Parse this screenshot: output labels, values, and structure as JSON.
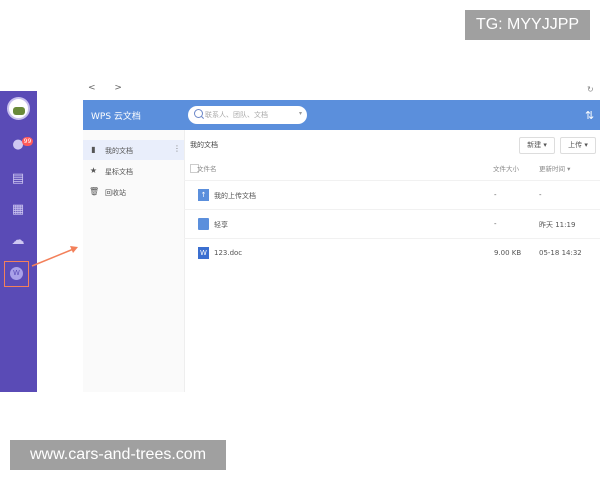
{
  "overlay": {
    "tg_badge": "TG: MYYJJPP",
    "watermark": "www.cars-and-trees.com"
  },
  "rail": {
    "items": [
      {
        "icon": "avatar"
      },
      {
        "icon": "chat-icon",
        "badge": "99"
      },
      {
        "icon": "document-icon"
      },
      {
        "icon": "apps-grid-icon"
      },
      {
        "icon": "cloud-icon"
      },
      {
        "icon": "wps-cloud-icon",
        "highlighted": true,
        "glyph": "W"
      }
    ]
  },
  "toolbar": {
    "back_forward": "< >"
  },
  "header": {
    "title": "WPS 云文档",
    "search_placeholder": "联系人、团队、文档",
    "sort_icon": "sort-arrows-icon"
  },
  "sidebar": {
    "items": [
      {
        "icon": "folder-icon",
        "label": "我的文档",
        "active": true
      },
      {
        "icon": "star-icon",
        "label": "星标文档"
      },
      {
        "icon": "trash-icon",
        "label": "回收站"
      }
    ]
  },
  "main": {
    "breadcrumb": "我的文档",
    "new_button": "新建 ▾",
    "upload_button": "上传 ▾",
    "columns": {
      "name": "文件名",
      "size": "文件大小",
      "modified": "更新时间 ▾"
    },
    "rows": [
      {
        "type": "upload-folder",
        "name": "我的上传文档",
        "size": "-",
        "modified": "-"
      },
      {
        "type": "folder",
        "name": "轻享",
        "size": "-",
        "modified": "昨天 11:19"
      },
      {
        "type": "doc",
        "name": "123.doc",
        "size": "9.00 KB",
        "modified": "05-18 14:32"
      }
    ]
  },
  "colors": {
    "rail": "#5a4bb6",
    "header": "#5b8fdc",
    "highlight": "#f3805a",
    "badge": "#ff5a5a"
  }
}
